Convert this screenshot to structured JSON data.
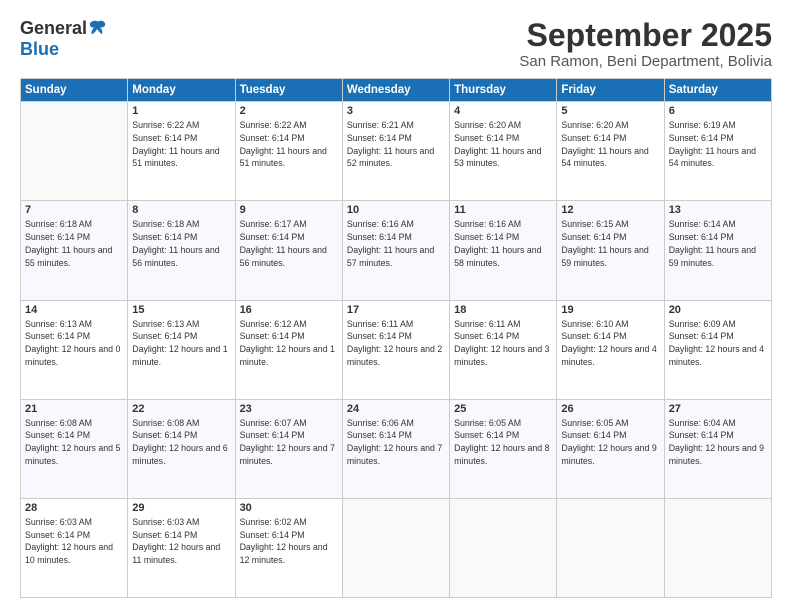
{
  "logo": {
    "general": "General",
    "blue": "Blue"
  },
  "header": {
    "month": "September 2025",
    "location": "San Ramon, Beni Department, Bolivia"
  },
  "days_of_week": [
    "Sunday",
    "Monday",
    "Tuesday",
    "Wednesday",
    "Thursday",
    "Friday",
    "Saturday"
  ],
  "weeks": [
    [
      {
        "day": "",
        "sunrise": "",
        "sunset": "",
        "daylight": ""
      },
      {
        "day": "1",
        "sunrise": "Sunrise: 6:22 AM",
        "sunset": "Sunset: 6:14 PM",
        "daylight": "Daylight: 11 hours and 51 minutes."
      },
      {
        "day": "2",
        "sunrise": "Sunrise: 6:22 AM",
        "sunset": "Sunset: 6:14 PM",
        "daylight": "Daylight: 11 hours and 51 minutes."
      },
      {
        "day": "3",
        "sunrise": "Sunrise: 6:21 AM",
        "sunset": "Sunset: 6:14 PM",
        "daylight": "Daylight: 11 hours and 52 minutes."
      },
      {
        "day": "4",
        "sunrise": "Sunrise: 6:20 AM",
        "sunset": "Sunset: 6:14 PM",
        "daylight": "Daylight: 11 hours and 53 minutes."
      },
      {
        "day": "5",
        "sunrise": "Sunrise: 6:20 AM",
        "sunset": "Sunset: 6:14 PM",
        "daylight": "Daylight: 11 hours and 54 minutes."
      },
      {
        "day": "6",
        "sunrise": "Sunrise: 6:19 AM",
        "sunset": "Sunset: 6:14 PM",
        "daylight": "Daylight: 11 hours and 54 minutes."
      }
    ],
    [
      {
        "day": "7",
        "sunrise": "Sunrise: 6:18 AM",
        "sunset": "Sunset: 6:14 PM",
        "daylight": "Daylight: 11 hours and 55 minutes."
      },
      {
        "day": "8",
        "sunrise": "Sunrise: 6:18 AM",
        "sunset": "Sunset: 6:14 PM",
        "daylight": "Daylight: 11 hours and 56 minutes."
      },
      {
        "day": "9",
        "sunrise": "Sunrise: 6:17 AM",
        "sunset": "Sunset: 6:14 PM",
        "daylight": "Daylight: 11 hours and 56 minutes."
      },
      {
        "day": "10",
        "sunrise": "Sunrise: 6:16 AM",
        "sunset": "Sunset: 6:14 PM",
        "daylight": "Daylight: 11 hours and 57 minutes."
      },
      {
        "day": "11",
        "sunrise": "Sunrise: 6:16 AM",
        "sunset": "Sunset: 6:14 PM",
        "daylight": "Daylight: 11 hours and 58 minutes."
      },
      {
        "day": "12",
        "sunrise": "Sunrise: 6:15 AM",
        "sunset": "Sunset: 6:14 PM",
        "daylight": "Daylight: 11 hours and 59 minutes."
      },
      {
        "day": "13",
        "sunrise": "Sunrise: 6:14 AM",
        "sunset": "Sunset: 6:14 PM",
        "daylight": "Daylight: 11 hours and 59 minutes."
      }
    ],
    [
      {
        "day": "14",
        "sunrise": "Sunrise: 6:13 AM",
        "sunset": "Sunset: 6:14 PM",
        "daylight": "Daylight: 12 hours and 0 minutes."
      },
      {
        "day": "15",
        "sunrise": "Sunrise: 6:13 AM",
        "sunset": "Sunset: 6:14 PM",
        "daylight": "Daylight: 12 hours and 1 minute."
      },
      {
        "day": "16",
        "sunrise": "Sunrise: 6:12 AM",
        "sunset": "Sunset: 6:14 PM",
        "daylight": "Daylight: 12 hours and 1 minute."
      },
      {
        "day": "17",
        "sunrise": "Sunrise: 6:11 AM",
        "sunset": "Sunset: 6:14 PM",
        "daylight": "Daylight: 12 hours and 2 minutes."
      },
      {
        "day": "18",
        "sunrise": "Sunrise: 6:11 AM",
        "sunset": "Sunset: 6:14 PM",
        "daylight": "Daylight: 12 hours and 3 minutes."
      },
      {
        "day": "19",
        "sunrise": "Sunrise: 6:10 AM",
        "sunset": "Sunset: 6:14 PM",
        "daylight": "Daylight: 12 hours and 4 minutes."
      },
      {
        "day": "20",
        "sunrise": "Sunrise: 6:09 AM",
        "sunset": "Sunset: 6:14 PM",
        "daylight": "Daylight: 12 hours and 4 minutes."
      }
    ],
    [
      {
        "day": "21",
        "sunrise": "Sunrise: 6:08 AM",
        "sunset": "Sunset: 6:14 PM",
        "daylight": "Daylight: 12 hours and 5 minutes."
      },
      {
        "day": "22",
        "sunrise": "Sunrise: 6:08 AM",
        "sunset": "Sunset: 6:14 PM",
        "daylight": "Daylight: 12 hours and 6 minutes."
      },
      {
        "day": "23",
        "sunrise": "Sunrise: 6:07 AM",
        "sunset": "Sunset: 6:14 PM",
        "daylight": "Daylight: 12 hours and 7 minutes."
      },
      {
        "day": "24",
        "sunrise": "Sunrise: 6:06 AM",
        "sunset": "Sunset: 6:14 PM",
        "daylight": "Daylight: 12 hours and 7 minutes."
      },
      {
        "day": "25",
        "sunrise": "Sunrise: 6:05 AM",
        "sunset": "Sunset: 6:14 PM",
        "daylight": "Daylight: 12 hours and 8 minutes."
      },
      {
        "day": "26",
        "sunrise": "Sunrise: 6:05 AM",
        "sunset": "Sunset: 6:14 PM",
        "daylight": "Daylight: 12 hours and 9 minutes."
      },
      {
        "day": "27",
        "sunrise": "Sunrise: 6:04 AM",
        "sunset": "Sunset: 6:14 PM",
        "daylight": "Daylight: 12 hours and 9 minutes."
      }
    ],
    [
      {
        "day": "28",
        "sunrise": "Sunrise: 6:03 AM",
        "sunset": "Sunset: 6:14 PM",
        "daylight": "Daylight: 12 hours and 10 minutes."
      },
      {
        "day": "29",
        "sunrise": "Sunrise: 6:03 AM",
        "sunset": "Sunset: 6:14 PM",
        "daylight": "Daylight: 12 hours and 11 minutes."
      },
      {
        "day": "30",
        "sunrise": "Sunrise: 6:02 AM",
        "sunset": "Sunset: 6:14 PM",
        "daylight": "Daylight: 12 hours and 12 minutes."
      },
      {
        "day": "",
        "sunrise": "",
        "sunset": "",
        "daylight": ""
      },
      {
        "day": "",
        "sunrise": "",
        "sunset": "",
        "daylight": ""
      },
      {
        "day": "",
        "sunrise": "",
        "sunset": "",
        "daylight": ""
      },
      {
        "day": "",
        "sunrise": "",
        "sunset": "",
        "daylight": ""
      }
    ]
  ]
}
